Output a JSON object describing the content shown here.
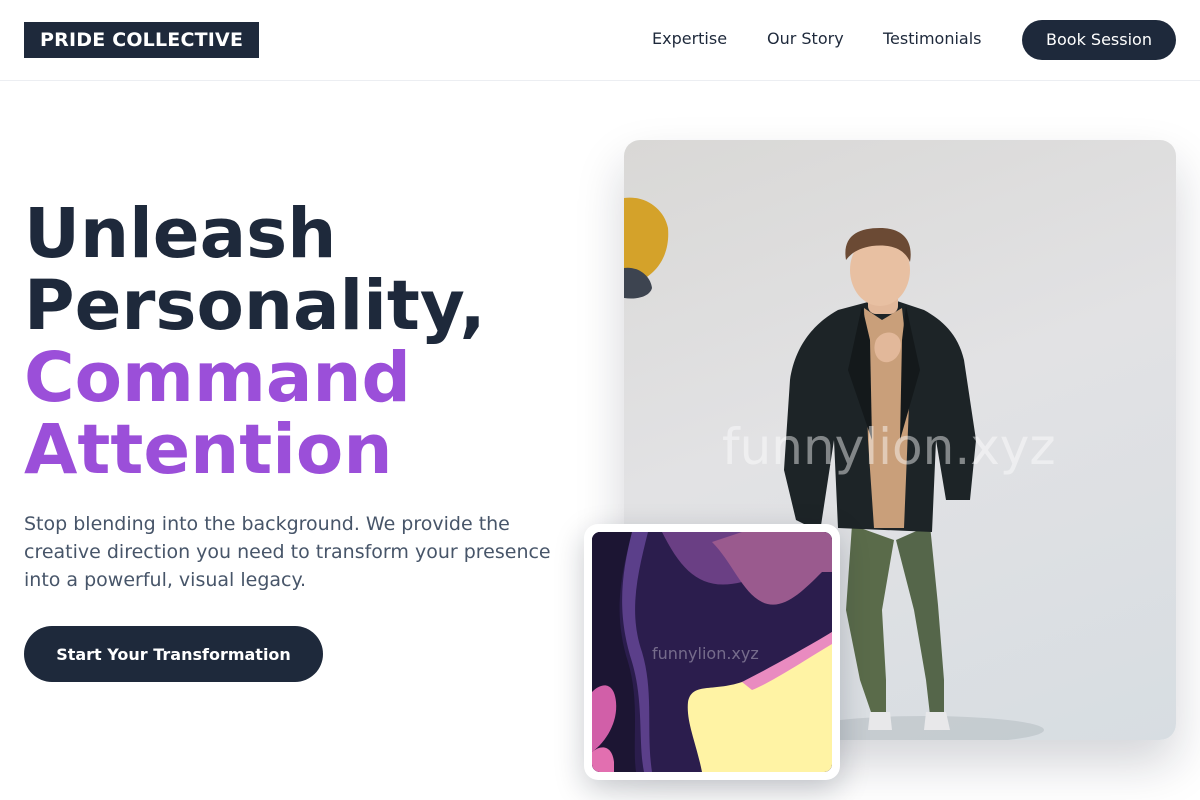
{
  "brand": {
    "logo_text": "PRIDE COLLECTIVE"
  },
  "nav": {
    "items": [
      {
        "label": "Expertise"
      },
      {
        "label": "Our Story"
      },
      {
        "label": "Testimonials"
      }
    ],
    "cta_label": "Book Session"
  },
  "hero": {
    "headline_line1": "Unleash",
    "headline_line2": "Personality,",
    "headline_line3": "Command",
    "headline_line4": "Attention",
    "subtext": "Stop blending into the background. We provide the creative direction you need to transform your presence into a powerful, visual legacy.",
    "cta_label": "Start Your Transformation"
  },
  "images": {
    "main_watermark": "funnylion.xyz",
    "art_watermark": "funnylion.xyz"
  },
  "colors": {
    "navy": "#1e293b",
    "accent_purple": "#9b4fd9",
    "body_text": "#475569"
  }
}
